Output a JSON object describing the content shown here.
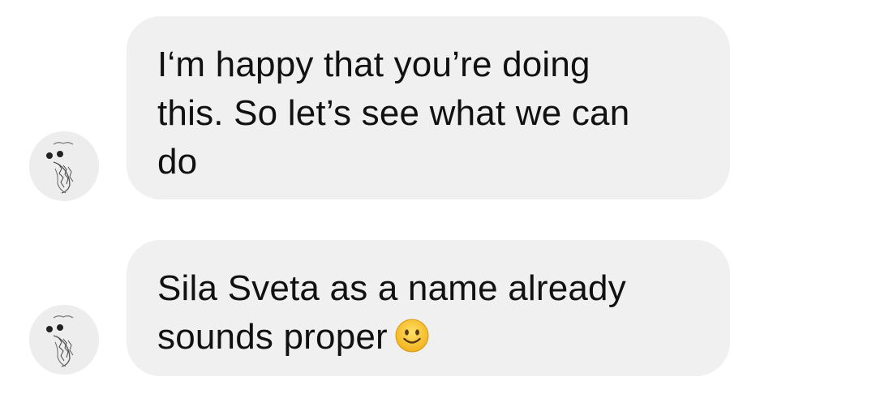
{
  "messages": [
    {
      "sender": "other",
      "text": "I‘m happy that you’re doing\nthis. So let’s see what we can\ndo",
      "avatar_icon": "sketch-avatar-icon"
    },
    {
      "sender": "other",
      "text": "Sila Sveta as a name already\nsounds proper",
      "emoji": "slightly-smiling-face-icon",
      "avatar_icon": "sketch-avatar-icon"
    }
  ],
  "colors": {
    "bubble": "#f0f0f0",
    "text": "#111111",
    "background": "#ffffff",
    "emoji_face": "#f7c531"
  }
}
